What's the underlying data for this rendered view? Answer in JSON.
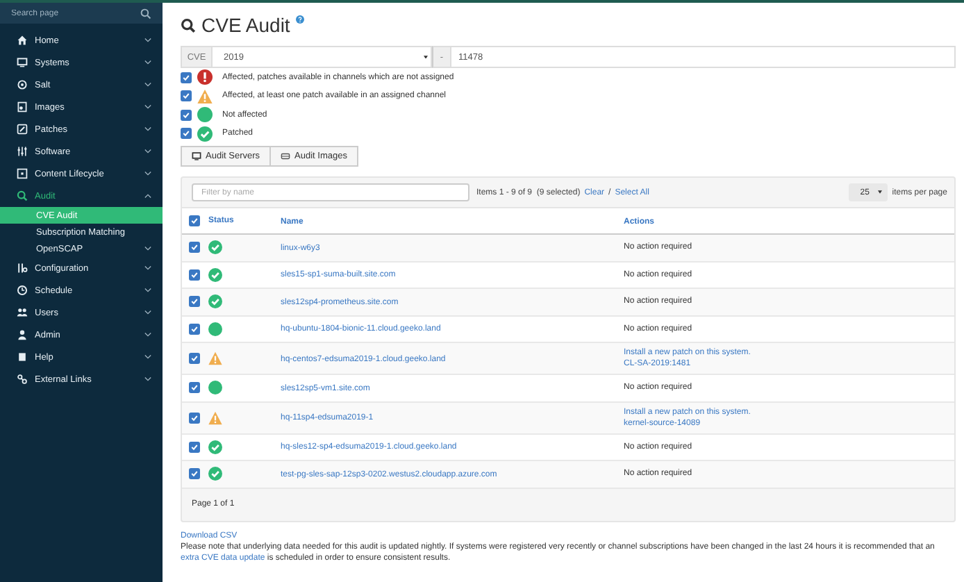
{
  "sidebar": {
    "search": {
      "placeholder": "Search page"
    },
    "items": [
      {
        "label": "Home",
        "selected": false,
        "expanded": false
      },
      {
        "label": "Systems",
        "selected": false,
        "expanded": false
      },
      {
        "label": "Salt",
        "selected": false,
        "expanded": false
      },
      {
        "label": "Images",
        "selected": false,
        "expanded": false
      },
      {
        "label": "Patches",
        "selected": false,
        "expanded": false
      },
      {
        "label": "Software",
        "selected": false,
        "expanded": false
      },
      {
        "label": "Content Lifecycle",
        "selected": false,
        "expanded": false
      },
      {
        "label": "Audit",
        "selected": true,
        "expanded": true,
        "children": [
          {
            "label": "CVE Audit",
            "selected": true
          },
          {
            "label": "Subscription Matching",
            "selected": false
          },
          {
            "label": "OpenSCAP",
            "selected": false,
            "expanded": false
          }
        ]
      },
      {
        "label": "Configuration",
        "selected": false,
        "expanded": false
      },
      {
        "label": "Schedule",
        "selected": false,
        "expanded": false
      },
      {
        "label": "Users",
        "selected": false,
        "expanded": false
      },
      {
        "label": "Admin",
        "selected": false,
        "expanded": false
      },
      {
        "label": "Help",
        "selected": false,
        "expanded": false
      },
      {
        "label": "External Links",
        "selected": false,
        "expanded": false
      }
    ]
  },
  "title": "CVE Audit",
  "cve": {
    "prefix": "CVE",
    "year": "2019",
    "separator": "-",
    "number": "11478"
  },
  "legend": [
    {
      "kind": "unassigned",
      "label": "Affected, patches available in channels which are not assigned",
      "checked": true
    },
    {
      "kind": "affected",
      "label": "Affected, at least one patch available in an assigned channel",
      "checked": true
    },
    {
      "kind": "not_affected",
      "label": "Not affected",
      "checked": true
    },
    {
      "kind": "patched",
      "label": "Patched",
      "checked": true
    }
  ],
  "buttons": [
    {
      "kind": "servers",
      "label": "Audit Servers"
    },
    {
      "kind": "images",
      "label": "Audit Images"
    }
  ],
  "table": {
    "filter": {
      "placeholder": "Filter by name"
    },
    "items": "Items 1 - 9 of 9  (9 selected)",
    "clear": "Clear",
    "slash": "/",
    "select_all": "Select All",
    "per_page": "25",
    "per_page_label": "items per page",
    "all_checked": true,
    "columns": [
      "Status",
      "Name",
      "Actions"
    ],
    "rows": [
      {
        "checked": true,
        "kind": "patched",
        "name": "linux-w6y3",
        "action": {
          "kind": "text",
          "lines": [
            "No action required"
          ]
        }
      },
      {
        "checked": true,
        "kind": "patched",
        "name": "sles15-sp1-suma-built.site.com",
        "action": {
          "kind": "text",
          "lines": [
            "No action required"
          ]
        }
      },
      {
        "checked": true,
        "kind": "patched",
        "name": "sles12sp4-prometheus.site.com",
        "action": {
          "kind": "text",
          "lines": [
            "No action required"
          ]
        }
      },
      {
        "checked": true,
        "kind": "not_affected",
        "name": "hq-ubuntu-1804-bionic-11.cloud.geeko.land",
        "action": {
          "kind": "text",
          "lines": [
            "No action required"
          ]
        }
      },
      {
        "checked": true,
        "kind": "affected",
        "name": "hq-centos7-edsuma2019-1.cloud.geeko.land",
        "action": {
          "kind": "link",
          "lines": [
            "Install a new patch on this system.",
            "CL-SA-2019:1481"
          ]
        }
      },
      {
        "checked": true,
        "kind": "not_affected",
        "name": "sles12sp5-vm1.site.com",
        "action": {
          "kind": "text",
          "lines": [
            "No action required"
          ]
        }
      },
      {
        "checked": true,
        "kind": "affected",
        "name": "hq-11sp4-edsuma2019-1",
        "action": {
          "kind": "link",
          "lines": [
            "Install a new patch on this system.",
            "kernel-source-14089"
          ]
        }
      },
      {
        "checked": true,
        "kind": "patched",
        "name": "hq-sles12-sp4-edsuma2019-1.cloud.geeko.land",
        "action": {
          "kind": "text",
          "lines": [
            "No action required"
          ]
        }
      },
      {
        "checked": true,
        "kind": "patched",
        "name": "test-pg-sles-sap-12sp3-0202.westus2.cloudapp.azure.com",
        "action": {
          "kind": "text",
          "lines": [
            "No action required"
          ]
        }
      }
    ],
    "footer": "Page 1 of 1"
  },
  "download": "Download CSV",
  "note": {
    "before": "Please note that underlying data needed for this audit is updated nightly. If systems were registered very recently or channel subscriptions have been changed in the last 24 hours it is recommended that an",
    "link": "extra CVE data update",
    "after": "is scheduled in order to ensure consistent results."
  }
}
